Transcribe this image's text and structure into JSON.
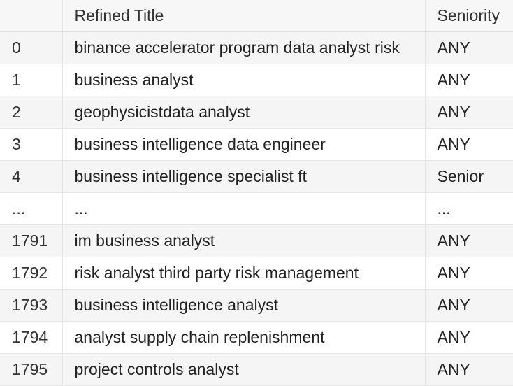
{
  "table": {
    "columns": [
      "",
      "Refined Title",
      "Seniority"
    ],
    "rows": [
      {
        "index": "0",
        "title": "binance accelerator program data analyst risk",
        "seniority": "ANY"
      },
      {
        "index": "1",
        "title": "business analyst",
        "seniority": "ANY"
      },
      {
        "index": "2",
        "title": "geophysicistdata analyst",
        "seniority": "ANY"
      },
      {
        "index": "3",
        "title": "business intelligence data engineer",
        "seniority": "ANY"
      },
      {
        "index": "4",
        "title": "business intelligence specialist ft",
        "seniority": "Senior"
      },
      {
        "index": "...",
        "title": "...",
        "seniority": "..."
      },
      {
        "index": "1791",
        "title": "im business analyst",
        "seniority": "ANY"
      },
      {
        "index": "1792",
        "title": "risk analyst third party risk management",
        "seniority": "ANY"
      },
      {
        "index": "1793",
        "title": "business intelligence analyst",
        "seniority": "ANY"
      },
      {
        "index": "1794",
        "title": "analyst supply chain replenishment",
        "seniority": "ANY"
      },
      {
        "index": "1795",
        "title": "project controls analyst",
        "seniority": "ANY"
      }
    ]
  }
}
